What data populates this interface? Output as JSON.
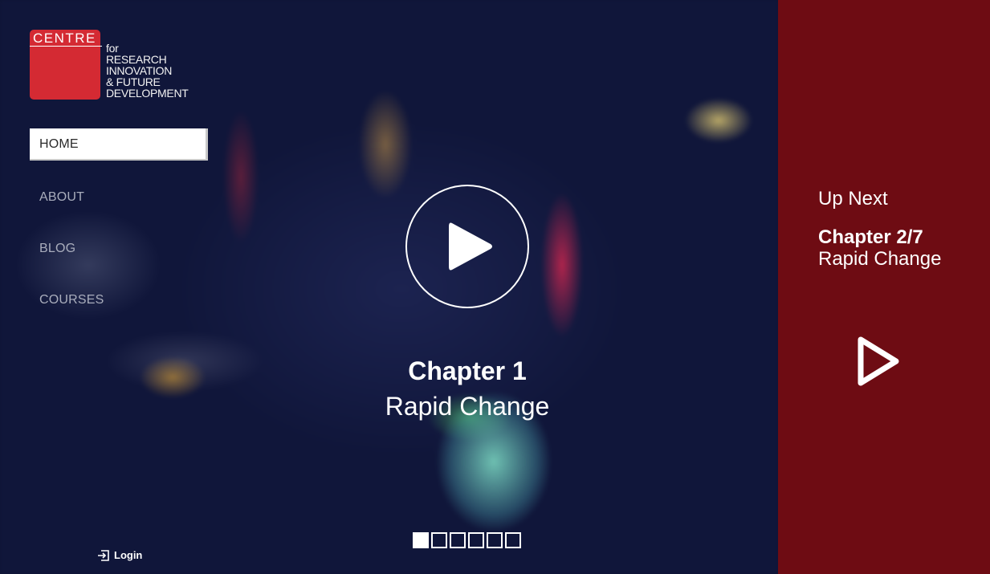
{
  "logo": {
    "word": "CENTRE",
    "lines": [
      "for",
      "RESEARCH",
      "INNOVATION",
      "& FUTURE",
      "DEVELOPMENT"
    ]
  },
  "nav": {
    "items": [
      {
        "label": "HOME",
        "active": true
      },
      {
        "label": "ABOUT",
        "active": false
      },
      {
        "label": "BLOG",
        "active": false
      },
      {
        "label": "COURSES",
        "active": false
      }
    ]
  },
  "player": {
    "chapter": "Chapter 1",
    "title": "Rapid Change",
    "play_icon": "play-icon"
  },
  "pager": {
    "total": 6,
    "current": 1
  },
  "login": {
    "label": "Login",
    "icon": "login-icon"
  },
  "up_next": {
    "heading": "Up Next",
    "chapter": "Chapter 2/7",
    "title": "Rapid Change",
    "play_icon": "play-outline-icon"
  },
  "colors": {
    "brand_red": "#d42a33",
    "panel_red": "#760e15",
    "background": "#10163a"
  }
}
